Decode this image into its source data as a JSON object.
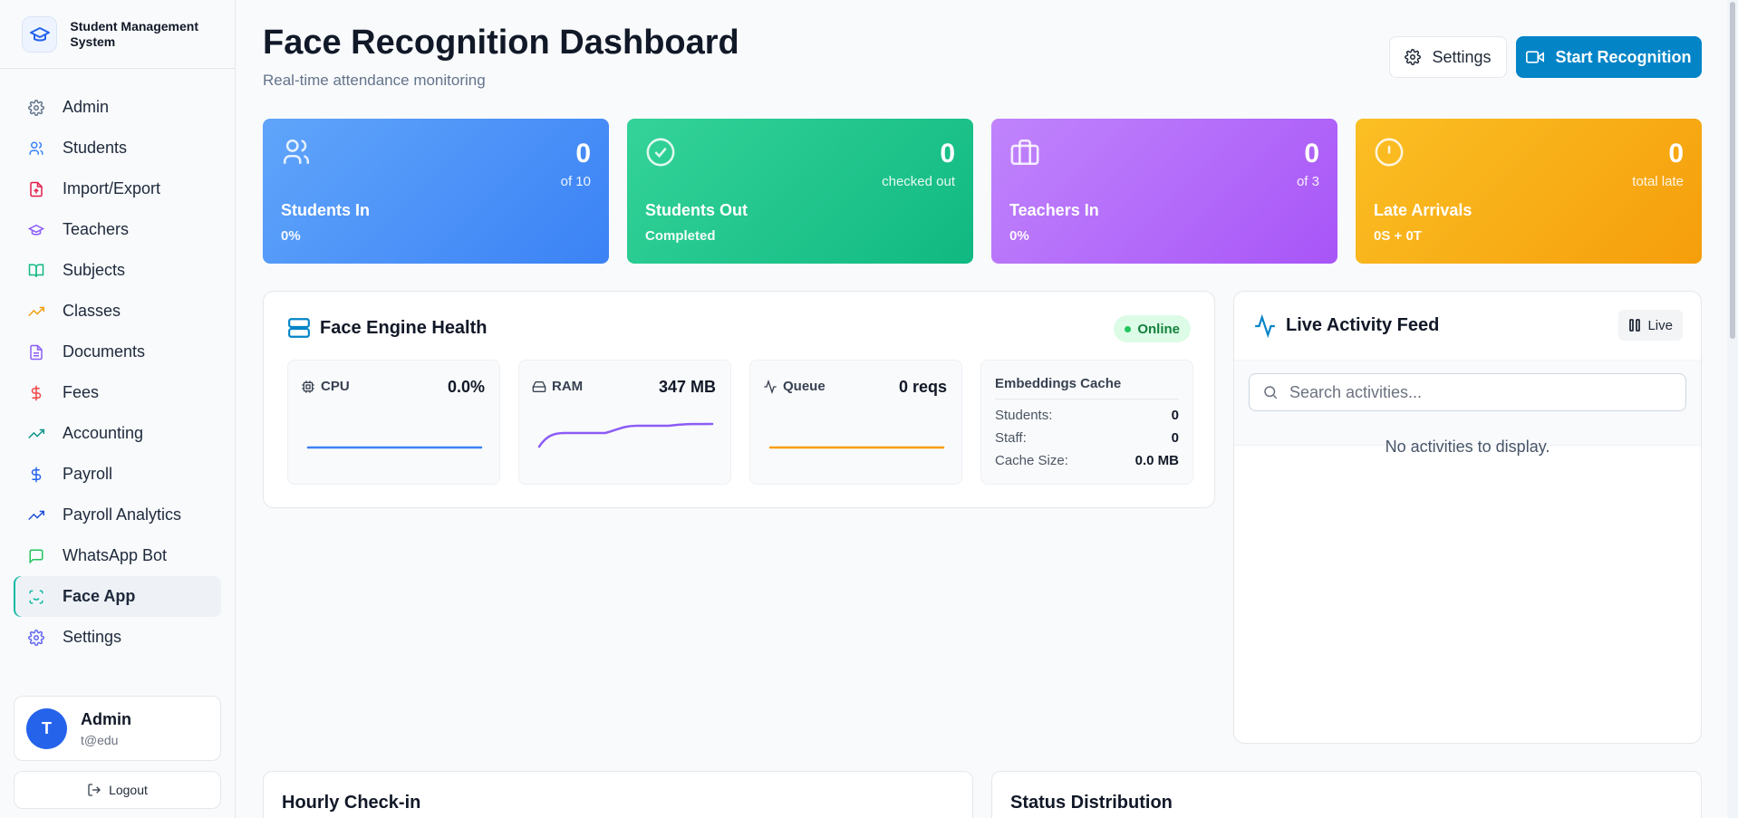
{
  "brand": {
    "name": "Student Management System"
  },
  "sidebar": {
    "items": [
      {
        "label": "Admin",
        "icon": "gear-icon"
      },
      {
        "label": "Students",
        "icon": "users-icon"
      },
      {
        "label": "Import/Export",
        "icon": "file-upload-icon"
      },
      {
        "label": "Teachers",
        "icon": "graduation-cap-icon"
      },
      {
        "label": "Subjects",
        "icon": "book-open-icon"
      },
      {
        "label": "Classes",
        "icon": "trending-up-icon"
      },
      {
        "label": "Documents",
        "icon": "document-icon"
      },
      {
        "label": "Fees",
        "icon": "dollar-icon"
      },
      {
        "label": "Accounting",
        "icon": "trending-up-icon"
      },
      {
        "label": "Payroll",
        "icon": "dollar-icon"
      },
      {
        "label": "Payroll Analytics",
        "icon": "trending-up-icon"
      },
      {
        "label": "WhatsApp Bot",
        "icon": "message-icon"
      },
      {
        "label": "Face App",
        "icon": "face-scan-icon"
      },
      {
        "label": "Settings",
        "icon": "gear-icon"
      }
    ],
    "active": "Face App"
  },
  "user": {
    "avatar_initial": "T",
    "name": "Admin",
    "email": "t@edu",
    "logout_label": "Logout"
  },
  "header": {
    "title": "Face Recognition Dashboard",
    "subtitle": "Real-time attendance monitoring",
    "settings_label": "Settings",
    "start_label": "Start Recognition"
  },
  "stats": [
    {
      "value": "0",
      "sub": "of 10",
      "label": "Students In",
      "foot": "0%",
      "icon": "users-icon"
    },
    {
      "value": "0",
      "sub": "checked out",
      "label": "Students Out",
      "foot": "Completed",
      "icon": "check-circle-icon"
    },
    {
      "value": "0",
      "sub": "of 3",
      "label": "Teachers In",
      "foot": "0%",
      "icon": "briefcase-icon"
    },
    {
      "value": "0",
      "sub": "total late",
      "label": "Late Arrivals",
      "foot": "0S + 0T",
      "icon": "alert-circle-icon"
    }
  ],
  "health": {
    "title": "Face Engine Health",
    "status": "Online",
    "cpu": {
      "label": "CPU",
      "value": "0.0%"
    },
    "ram": {
      "label": "RAM",
      "value": "347 MB"
    },
    "queue": {
      "label": "Queue",
      "value": "0 reqs"
    },
    "cache": {
      "title": "Embeddings Cache",
      "rows": [
        {
          "label": "Students:",
          "value": "0"
        },
        {
          "label": "Staff:",
          "value": "0"
        },
        {
          "label": "Cache Size:",
          "value": "0.0 MB"
        }
      ]
    },
    "colors": {
      "cpu": "#3b82f6",
      "ram": "#8b5cf6",
      "queue": "#f59e0b"
    }
  },
  "feed": {
    "title": "Live Activity Feed",
    "live_label": "Live",
    "search_placeholder": "Search activities...",
    "empty_text": "No activities to display."
  },
  "panels": {
    "hourly_title": "Hourly Check-in",
    "status_title": "Status Distribution"
  },
  "colors": {
    "primary": "#0284c7",
    "accent_active": "#14b8a6"
  }
}
